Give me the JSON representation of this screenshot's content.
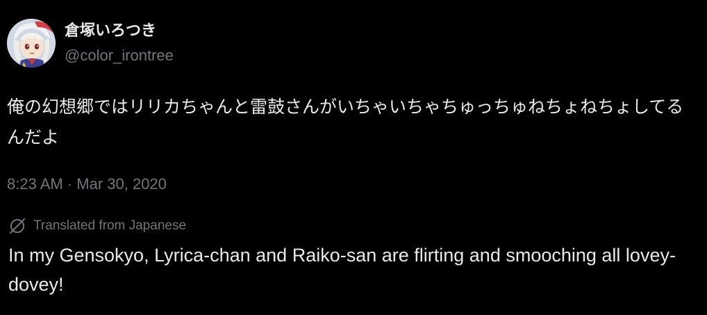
{
  "author": {
    "display_name": "倉塚いろつき",
    "handle": "@color_irontree",
    "avatar_icon": "character-avatar-icon"
  },
  "tweet": {
    "text": "俺の幻想郷ではリリカちゃんと雷鼓さんがいちゃいちゃちゅっちゅねちょねちょしてるんだよ",
    "timestamp": "8:23 AM · Mar 30, 2020"
  },
  "translation": {
    "label": "Translated from Japanese",
    "icon": "translate-globe-icon",
    "text": " In my Gensokyo, Lyrica-chan and Raiko-san are flirting and smooching all lovey-dovey!"
  },
  "colors": {
    "background": "#000000",
    "primary_text": "#e7e9ea",
    "secondary_text": "#71767b"
  }
}
